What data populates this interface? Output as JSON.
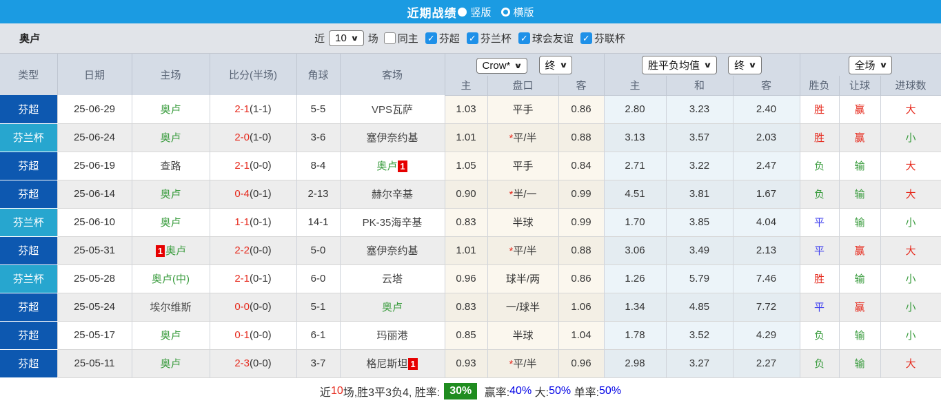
{
  "title_bar": {
    "title": "近期战绩",
    "vertical_label": "竖版",
    "horizontal_label": "横版"
  },
  "filter_bar": {
    "team": "奥卢",
    "near_label": "近",
    "matches_value": "10",
    "matches_label": "场",
    "same_home_label": "同主",
    "leagues": [
      {
        "label": "芬超",
        "checked": true
      },
      {
        "label": "芬兰杯",
        "checked": true
      },
      {
        "label": "球会友谊",
        "checked": true
      },
      {
        "label": "芬联杯",
        "checked": true
      }
    ]
  },
  "table": {
    "dropdowns": {
      "company": "Crow*",
      "company_time": "终",
      "avg": "胜平负均值",
      "avg_time": "终",
      "scope": "全场"
    },
    "headers": {
      "type": "类型",
      "date": "日期",
      "home": "主场",
      "score": "比分(半场)",
      "corner": "角球",
      "away": "客场",
      "odds_home": "主",
      "odds_hcp": "盘口",
      "odds_away": "客",
      "avg_home": "主",
      "avg_draw": "和",
      "avg_away": "客",
      "wdl": "胜负",
      "hcp_result": "让球",
      "goals_result": "进球数"
    },
    "rows": [
      {
        "league": "芬超",
        "league_type": "super",
        "date": "25-06-29",
        "home": {
          "name": "奥卢",
          "color": "green"
        },
        "score": "2-1",
        "half": "(1-1)",
        "corners": "5-5",
        "away": {
          "name": "VPS瓦萨",
          "color": "dark"
        },
        "odds": {
          "home": "1.03",
          "star": false,
          "hcp": "平手",
          "away": "0.86"
        },
        "avg": {
          "home": "2.80",
          "draw": "3.23",
          "away": "2.40"
        },
        "results": {
          "wdl": {
            "text": "胜",
            "color": "red"
          },
          "hcp": {
            "text": "赢",
            "color": "red"
          },
          "goals": {
            "text": "大",
            "color": "red"
          }
        }
      },
      {
        "league": "芬兰杯",
        "league_type": "cup",
        "date": "25-06-24",
        "home": {
          "name": "奥卢",
          "color": "green"
        },
        "score": "2-0",
        "half": "(1-0)",
        "corners": "3-6",
        "away": {
          "name": "塞伊奈约基",
          "color": "dark"
        },
        "odds": {
          "home": "1.01",
          "star": true,
          "hcp": "平/半",
          "away": "0.88"
        },
        "avg": {
          "home": "3.13",
          "draw": "3.57",
          "away": "2.03"
        },
        "results": {
          "wdl": {
            "text": "胜",
            "color": "red"
          },
          "hcp": {
            "text": "赢",
            "color": "red"
          },
          "goals": {
            "text": "小",
            "color": "green"
          }
        }
      },
      {
        "league": "芬超",
        "league_type": "super",
        "date": "25-06-19",
        "home": {
          "name": "查路",
          "color": "dark"
        },
        "score": "2-1",
        "half": "(0-0)",
        "corners": "8-4",
        "away": {
          "name": "奥卢",
          "color": "green",
          "badge": "1"
        },
        "odds": {
          "home": "1.05",
          "star": false,
          "hcp": "平手",
          "away": "0.84"
        },
        "avg": {
          "home": "2.71",
          "draw": "3.22",
          "away": "2.47"
        },
        "results": {
          "wdl": {
            "text": "负",
            "color": "green"
          },
          "hcp": {
            "text": "输",
            "color": "green"
          },
          "goals": {
            "text": "大",
            "color": "red"
          }
        }
      },
      {
        "league": "芬超",
        "league_type": "super",
        "date": "25-06-14",
        "home": {
          "name": "奥卢",
          "color": "green"
        },
        "score": "0-4",
        "half": "(0-1)",
        "corners": "2-13",
        "away": {
          "name": "赫尔辛基",
          "color": "dark"
        },
        "odds": {
          "home": "0.90",
          "star": true,
          "hcp": "半/一",
          "away": "0.99"
        },
        "avg": {
          "home": "4.51",
          "draw": "3.81",
          "away": "1.67"
        },
        "results": {
          "wdl": {
            "text": "负",
            "color": "green"
          },
          "hcp": {
            "text": "输",
            "color": "green"
          },
          "goals": {
            "text": "大",
            "color": "red"
          }
        }
      },
      {
        "league": "芬兰杯",
        "league_type": "cup",
        "date": "25-06-10",
        "home": {
          "name": "奥卢",
          "color": "green"
        },
        "score": "1-1",
        "half": "(0-1)",
        "corners": "14-1",
        "away": {
          "name": "PK-35海辛基",
          "color": "dark"
        },
        "odds": {
          "home": "0.83",
          "star": false,
          "hcp": "半球",
          "away": "0.99"
        },
        "avg": {
          "home": "1.70",
          "draw": "3.85",
          "away": "4.04"
        },
        "results": {
          "wdl": {
            "text": "平",
            "color": "blue"
          },
          "hcp": {
            "text": "输",
            "color": "green"
          },
          "goals": {
            "text": "小",
            "color": "green"
          }
        }
      },
      {
        "league": "芬超",
        "league_type": "super",
        "date": "25-05-31",
        "home": {
          "name": "奥卢",
          "color": "green",
          "badge": "1",
          "badge_pos": "before"
        },
        "score": "2-2",
        "half": "(0-0)",
        "corners": "5-0",
        "away": {
          "name": "塞伊奈约基",
          "color": "dark"
        },
        "odds": {
          "home": "1.01",
          "star": true,
          "hcp": "平/半",
          "away": "0.88"
        },
        "avg": {
          "home": "3.06",
          "draw": "3.49",
          "away": "2.13"
        },
        "results": {
          "wdl": {
            "text": "平",
            "color": "blue"
          },
          "hcp": {
            "text": "赢",
            "color": "red"
          },
          "goals": {
            "text": "大",
            "color": "red"
          }
        }
      },
      {
        "league": "芬兰杯",
        "league_type": "cup",
        "date": "25-05-28",
        "home": {
          "name": "奥卢(中)",
          "color": "green"
        },
        "score": "2-1",
        "half": "(0-1)",
        "corners": "6-0",
        "away": {
          "name": "云塔",
          "color": "dark"
        },
        "odds": {
          "home": "0.96",
          "star": false,
          "hcp": "球半/两",
          "away": "0.86"
        },
        "avg": {
          "home": "1.26",
          "draw": "5.79",
          "away": "7.46"
        },
        "results": {
          "wdl": {
            "text": "胜",
            "color": "red"
          },
          "hcp": {
            "text": "输",
            "color": "green"
          },
          "goals": {
            "text": "小",
            "color": "green"
          }
        }
      },
      {
        "league": "芬超",
        "league_type": "super",
        "date": "25-05-24",
        "home": {
          "name": "埃尔维斯",
          "color": "dark"
        },
        "score": "0-0",
        "half": "(0-0)",
        "corners": "5-1",
        "away": {
          "name": "奥卢",
          "color": "green"
        },
        "odds": {
          "home": "0.83",
          "star": false,
          "hcp": "一/球半",
          "away": "1.06"
        },
        "avg": {
          "home": "1.34",
          "draw": "4.85",
          "away": "7.72"
        },
        "results": {
          "wdl": {
            "text": "平",
            "color": "blue"
          },
          "hcp": {
            "text": "赢",
            "color": "red"
          },
          "goals": {
            "text": "小",
            "color": "green"
          }
        }
      },
      {
        "league": "芬超",
        "league_type": "super",
        "date": "25-05-17",
        "home": {
          "name": "奥卢",
          "color": "green"
        },
        "score": "0-1",
        "half": "(0-0)",
        "corners": "6-1",
        "away": {
          "name": "玛丽港",
          "color": "dark"
        },
        "odds": {
          "home": "0.85",
          "star": false,
          "hcp": "半球",
          "away": "1.04"
        },
        "avg": {
          "home": "1.78",
          "draw": "3.52",
          "away": "4.29"
        },
        "results": {
          "wdl": {
            "text": "负",
            "color": "green"
          },
          "hcp": {
            "text": "输",
            "color": "green"
          },
          "goals": {
            "text": "小",
            "color": "green"
          }
        }
      },
      {
        "league": "芬超",
        "league_type": "super",
        "date": "25-05-11",
        "home": {
          "name": "奥卢",
          "color": "green"
        },
        "score": "2-3",
        "half": "(0-0)",
        "corners": "3-7",
        "away": {
          "name": "格尼斯坦",
          "color": "dark",
          "badge": "1"
        },
        "odds": {
          "home": "0.93",
          "star": true,
          "hcp": "平/半",
          "away": "0.96"
        },
        "avg": {
          "home": "2.98",
          "draw": "3.27",
          "away": "2.27"
        },
        "results": {
          "wdl": {
            "text": "负",
            "color": "green"
          },
          "hcp": {
            "text": "输",
            "color": "green"
          },
          "goals": {
            "text": "大",
            "color": "red"
          }
        }
      }
    ]
  },
  "footer": {
    "seg_near": "近",
    "seg_count": "10",
    "seg_record": "场,胜3平3负4, 胜率:",
    "win_rate": "30%",
    "seg_hcp_label": " 赢率:",
    "hcp_rate": "40%",
    "seg_big_label": " 大:",
    "big_rate": "50%",
    "seg_single_label": " 单率:",
    "single_rate": "50%"
  },
  "colors": {
    "title_bar": "#1b9be2",
    "league_super": "#0d58b0",
    "league_cup": "#27a6cf",
    "team_green": "#3a9c3e",
    "score_red": "#e6291c",
    "draw_blue": "#4040ef",
    "win_badge_green": "#1f8c1f",
    "percent_blue": "#0000e6"
  }
}
